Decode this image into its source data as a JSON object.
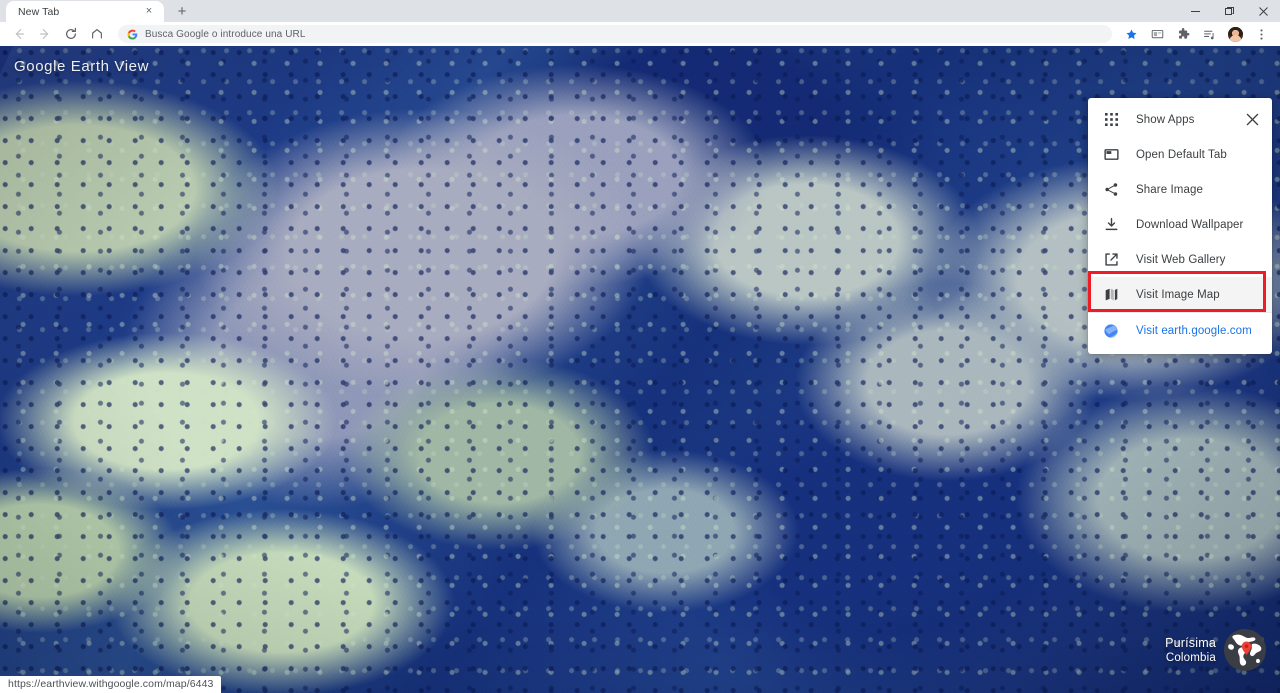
{
  "window": {
    "controls": {
      "minimize_label": "Minimize",
      "maximize_label": "Restore",
      "close_label": "Close"
    }
  },
  "tabs": [
    {
      "title": "New Tab",
      "close_label": "×"
    }
  ],
  "newtab_button_label": "+",
  "toolbar": {
    "back_label": "Back",
    "forward_label": "Forward",
    "reload_label": "Reload",
    "home_label": "Home",
    "omnibox": {
      "placeholder": "Busca Google o introduce una URL",
      "value": "",
      "search_engine_icon": "google-g-icon"
    },
    "bookmark_star_label": "Bookmark this tab",
    "extensions": [
      {
        "name": "media-router-icon"
      },
      {
        "name": "extensions-puzzle-icon"
      },
      {
        "name": "reading-list-icon"
      }
    ],
    "profile_label": "Profile",
    "menu_label": "Customize and control Google Chrome"
  },
  "page": {
    "watermark": "Google  Earth View",
    "location": {
      "name": "Purísima",
      "country": "Colombia",
      "pin_color": "#ea4335",
      "globe_fill": "rgba(60,64,67,0.78)"
    }
  },
  "extension_menu": {
    "visible": true,
    "close_label": "✕",
    "items": [
      {
        "icon": "apps-grid-icon",
        "label": "Show Apps",
        "highlighted": false,
        "is_link": false
      },
      {
        "icon": "default-tab-icon",
        "label": "Open Default Tab",
        "highlighted": false,
        "is_link": false
      },
      {
        "icon": "share-icon",
        "label": "Share Image",
        "highlighted": false,
        "is_link": false
      },
      {
        "icon": "download-icon",
        "label": "Download Wallpaper",
        "highlighted": false,
        "is_link": false
      },
      {
        "icon": "external-link-icon",
        "label": "Visit Web Gallery",
        "highlighted": false,
        "is_link": false
      },
      {
        "icon": "map-icon",
        "label": "Visit Image Map",
        "highlighted": true,
        "is_link": false
      },
      {
        "icon": "earth-sphere-icon",
        "label": "Visit earth.google.com",
        "highlighted": false,
        "is_link": true
      }
    ]
  },
  "annotation": {
    "target_label": "Visit Image Map",
    "box_color": "#ee1c25"
  },
  "status_bar": {
    "url": "https://earthview.withgoogle.com/map/6443"
  }
}
